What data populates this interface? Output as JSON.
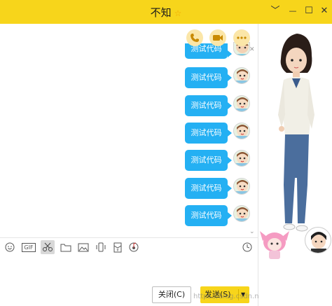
{
  "window": {
    "title": "不知",
    "star": "☆",
    "controls": {
      "collapse": "﹀",
      "minimize": "—",
      "maximize": "☐",
      "close": "✕"
    }
  },
  "actions": [
    "phone-icon",
    "video-icon",
    "more-icon"
  ],
  "messages": [
    "测试代码",
    "测试代码",
    "测试代码",
    "测试代码",
    "测试代码",
    "测试代码",
    "测试代码"
  ],
  "toolbar": {
    "gif_label": "GIF",
    "tools": [
      "emoji-icon",
      "gif-icon",
      "scissors-icon",
      "folder-icon",
      "image-icon",
      "shake-icon",
      "red-packet-icon",
      "music-icon",
      "history-icon"
    ]
  },
  "buttons": {
    "close_label": "关闭(C)",
    "send_label": "发送(S)",
    "send_caret": "▼"
  },
  "watermark": "https://blog.csdn.net/wjb123sw99",
  "colors": {
    "titlebar": "#f7d51b",
    "bubble": "#24b0f3",
    "send": "#f7d51b"
  }
}
